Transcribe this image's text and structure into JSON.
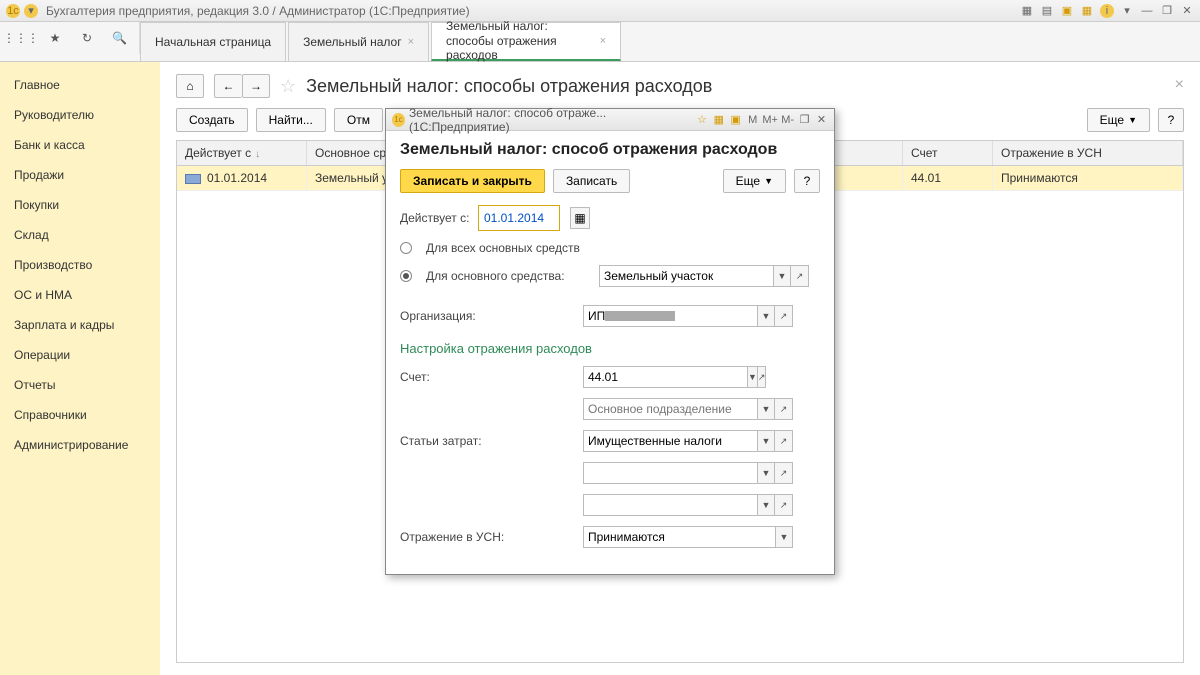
{
  "titlebar": {
    "text": "Бухгалтерия предприятия, редакция 3.0 / Администратор  (1С:Предприятие)"
  },
  "tabs": {
    "home": "Начальная страница",
    "t1": "Земельный налог",
    "t2": "Земельный налог: способы отражения расходов"
  },
  "sidebar": {
    "items": [
      "Главное",
      "Руководителю",
      "Банк и касса",
      "Продажи",
      "Покупки",
      "Склад",
      "Производство",
      "ОС и НМА",
      "Зарплата и кадры",
      "Операции",
      "Отчеты",
      "Справочники",
      "Администрирование"
    ]
  },
  "page": {
    "title": "Земельный налог: способы отражения расходов",
    "create": "Создать",
    "find": "Найти...",
    "cancel": "Отм",
    "more": "Еще",
    "help": "?"
  },
  "grid": {
    "headers": {
      "c1": "Действует с",
      "c2": "Основное ср",
      "c3": "Счет",
      "c4": "Отражение в УСН"
    },
    "row": {
      "date": "01.01.2014",
      "os": "Земельный уч",
      "account": "44.01",
      "usn": "Принимаются"
    }
  },
  "dialog": {
    "winTitle": "Земельный налог: способ отраже...  (1С:Предприятие)",
    "title": "Земельный налог: способ отражения расходов",
    "saveClose": "Записать и закрыть",
    "save": "Записать",
    "more": "Еще",
    "help": "?",
    "effectiveFrom": "Действует с:",
    "date": "01.01.2014",
    "forAll": "Для всех основных средств",
    "forOne": "Для основного средства:",
    "asset": "Земельный участок",
    "orgLabel": "Организация:",
    "orgValue": "ИП ",
    "section": "Настройка отражения расходов",
    "accountLabel": "Счет:",
    "accountValue": "44.01",
    "subdivision": "Основное подразделение",
    "costItemsLabel": "Статьи затрат:",
    "costItemsValue": "Имущественные налоги",
    "usnLabel": "Отражение в УСН:",
    "usnValue": "Принимаются",
    "mIcons": [
      "M",
      "M+",
      "M-"
    ]
  }
}
